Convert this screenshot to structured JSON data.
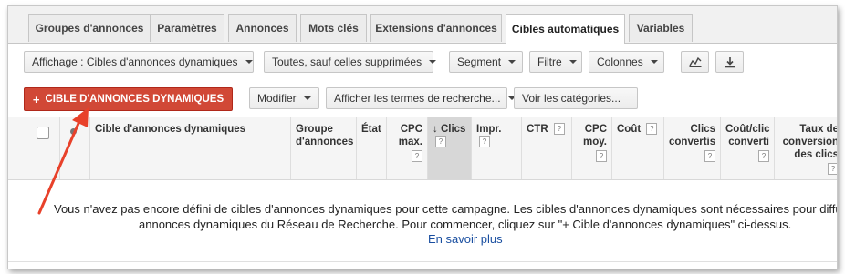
{
  "tabs": [
    {
      "label": "Groupes d'annonces"
    },
    {
      "label": "Paramètres"
    },
    {
      "label": "Annonces"
    },
    {
      "label": "Mots clés"
    },
    {
      "label": "Extensions d'annonces"
    },
    {
      "label": "Cibles automatiques"
    },
    {
      "label": "Variables"
    }
  ],
  "toolbar": {
    "view_label": "Affichage : Cibles d'annonces dynamiques",
    "filter_status": "Toutes, sauf celles supprimées",
    "segment": "Segment",
    "filter": "Filtre",
    "columns": "Colonnes"
  },
  "actions": {
    "add_target": "CIBLE D'ANNONCES DYNAMIQUES",
    "add_plus": "+",
    "modify": "Modifier",
    "show_search_terms": "Afficher les termes de recherche...",
    "view_categories": "Voir les catégories..."
  },
  "table": {
    "headers": {
      "target": "Cible d'annonces dynamiques",
      "ad_group_1": "Groupe",
      "ad_group_2": "d'annonces",
      "status": "État",
      "max_cpc_1": "CPC",
      "max_cpc_2": "max.",
      "clicks": "Clics",
      "clicks_sort": "↓",
      "impr": "Impr.",
      "ctr": "CTR",
      "avg_cpc_1": "CPC",
      "avg_cpc_2": "moy.",
      "cost": "Coût",
      "conv_1": "Clics",
      "conv_2": "convertis",
      "cost_conv_1": "Coût/clic",
      "cost_conv_2": "converti",
      "conv_rate_1": "Taux de",
      "conv_rate_2": "conversion",
      "conv_rate_3": "des clics"
    },
    "help": "?",
    "empty_line1": "Vous n'avez pas encore défini de cibles d'annonces dynamiques pour cette campagne. Les cibles d'annonces dynamiques sont nécessaires pour diffuser des",
    "empty_line2": "annonces dynamiques du Réseau de Recherche. Pour commencer, cliquez sur \"+ Cible d'annonces dynamiques\" ci-dessus.",
    "learn_more": "En savoir plus"
  },
  "colors": {
    "accent_red": "#d14836",
    "link": "#1a4fa0",
    "annotation_arrow": "#e8412a"
  }
}
